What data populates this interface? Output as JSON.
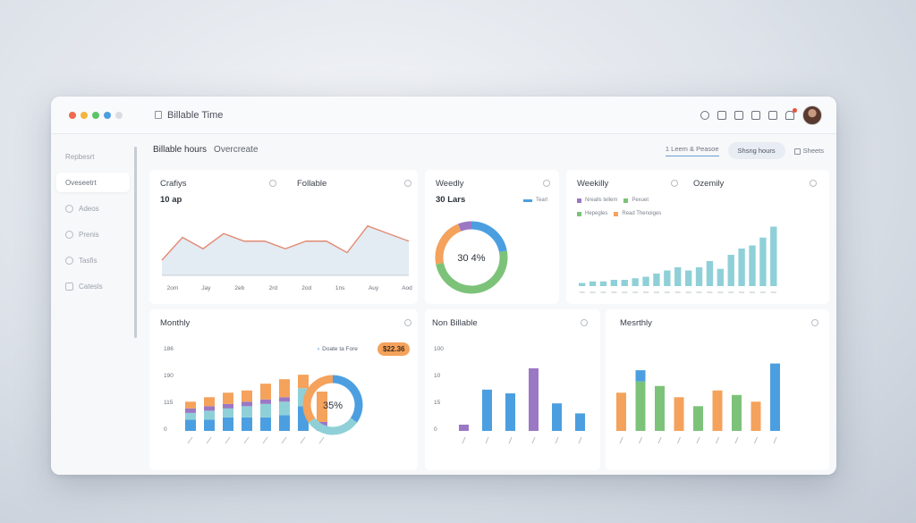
{
  "window": {
    "title": "Billable Time",
    "traffic_colors": [
      "#ef6a4e",
      "#f4b53f",
      "#5cc468",
      "#4b9fe0",
      "#d9dde3"
    ]
  },
  "toolbar_icons": [
    "search-icon",
    "print-icon",
    "lock-icon",
    "copy-icon",
    "folder-icon",
    "bell-icon"
  ],
  "sidebar": {
    "items": [
      {
        "label": "Repbesrt",
        "icon": "none"
      },
      {
        "label": "Oveseetrt",
        "icon": "none",
        "active": true
      },
      {
        "label": "Adeos",
        "icon": "circle-icon"
      },
      {
        "label": "Prenis",
        "icon": "circle-icon"
      },
      {
        "label": "Tasfis",
        "icon": "circle-icon"
      },
      {
        "label": "Catesls",
        "icon": "square-icon"
      }
    ]
  },
  "header": {
    "title": "Billable hours",
    "subtitle": "Overcreate",
    "filter_link": "1 Leem & Peasoe",
    "primary_button": "Shsng hours",
    "extra_label": "Sheets"
  },
  "cards": {
    "trend": {
      "tab1": "Crafiys",
      "tab2": "Follable",
      "value": "10 ap"
    },
    "weekly_donut": {
      "title": "Weedly",
      "value": "30 Lars",
      "legend": "Tearl",
      "center": "30 4%"
    },
    "weekly_bars": {
      "title1": "Weekilly",
      "title2": "Ozemily",
      "legend1": "Nrealls tellem",
      "legend2": "Pexuet",
      "legend3": "Hepegles",
      "legend4": "Read Thenoiges"
    },
    "monthly": {
      "title": "Monthly",
      "link": "Doate ta Fore",
      "pill": "$22.36",
      "center": "35%",
      "y_ticks": [
        "186",
        "190",
        "115",
        "0"
      ]
    },
    "non_billable": {
      "title": "Non Billable",
      "y_ticks": [
        "100",
        "10",
        "15",
        "0"
      ]
    },
    "monthly2": {
      "title": "Mesrthly"
    }
  },
  "colors": {
    "blue": "#4b9fe0",
    "orange": "#f4a25c",
    "green": "#7cc379",
    "teal": "#8fd0d8",
    "purple": "#9b78c4",
    "red_line": "#e38a73"
  },
  "chart_data": [
    {
      "type": "area",
      "title": "Crafiys",
      "x_ticks": [
        "2om",
        "Jay",
        "2eb",
        "2rd",
        "2od",
        "1ns",
        "Auy",
        "Aod"
      ],
      "values": [
        4,
        10,
        7,
        11,
        9,
        9,
        7,
        9,
        9,
        6,
        13,
        11,
        9
      ],
      "ylim": [
        0,
        16
      ]
    },
    {
      "type": "pie",
      "title": "Weedly",
      "center_label": "30 4%",
      "slices": [
        {
          "color": "#4b9fe0",
          "value": 22
        },
        {
          "color": "#7cc379",
          "value": 50
        },
        {
          "color": "#f4a25c",
          "value": 22
        },
        {
          "color": "#9b78c4",
          "value": 6
        }
      ]
    },
    {
      "type": "bar",
      "title": "Ozemily",
      "values": [
        2,
        3,
        3,
        4,
        4,
        5,
        6,
        8,
        10,
        12,
        10,
        12,
        16,
        11,
        20,
        24,
        26,
        31,
        38
      ],
      "ylim": [
        0,
        40
      ]
    },
    {
      "type": "bar",
      "title": "Monthly",
      "stacked": true,
      "series": [
        {
          "color": "#4b9fe0",
          "values": [
            10,
            10,
            12,
            12,
            12,
            14,
            22,
            5
          ]
        },
        {
          "color": "#8fd0d8",
          "values": [
            6,
            8,
            8,
            10,
            12,
            12,
            16,
            0
          ]
        },
        {
          "color": "#9b78c4",
          "values": [
            4,
            4,
            4,
            4,
            4,
            4,
            0,
            3
          ]
        },
        {
          "color": "#f4a25c",
          "values": [
            6,
            8,
            10,
            10,
            14,
            16,
            12,
            27
          ]
        }
      ],
      "ylim": [
        0,
        70
      ]
    },
    {
      "type": "pie",
      "title": "Monthly",
      "center_label": "35%",
      "slices": [
        {
          "color": "#4b9fe0",
          "value": 35
        },
        {
          "color": "#8fd0d8",
          "value": 30
        },
        {
          "color": "#f4a25c",
          "value": 35
        }
      ]
    },
    {
      "type": "bar",
      "title": "Non Billable",
      "categories": [
        1,
        2,
        3,
        4,
        5,
        6
      ],
      "values": [
        5,
        33,
        30,
        50,
        22,
        14
      ],
      "colors": [
        "#9b78c4",
        "#4b9fe0",
        "#4b9fe0",
        "#9b78c4",
        "#4b9fe0",
        "#4b9fe0"
      ],
      "ylim": [
        0,
        60
      ]
    },
    {
      "type": "bar",
      "title": "Mesrthly",
      "values": [
        17,
        22,
        20,
        15,
        11,
        18,
        16,
        13,
        30
      ],
      "top_values": [
        0,
        5,
        0,
        0,
        0,
        0,
        0,
        0,
        0
      ],
      "colors": [
        "#f4a25c",
        "#7cc379",
        "#7cc379",
        "#f4a25c",
        "#7cc379",
        "#f4a25c",
        "#7cc379",
        "#f4a25c",
        "#4b9fe0"
      ],
      "ylim": [
        0,
        35
      ]
    }
  ]
}
